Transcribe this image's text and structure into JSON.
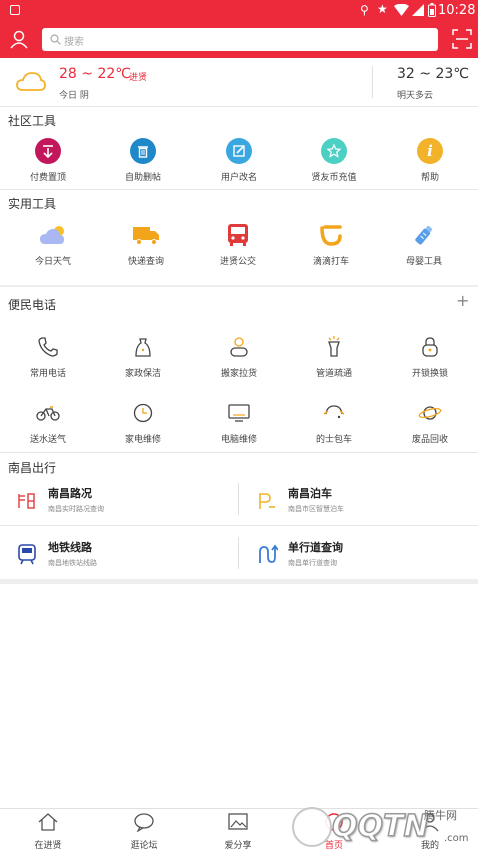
{
  "status": {
    "time": "10:28",
    "notification_icon": "photo-icon",
    "icons": [
      "location-icon",
      "star-icon",
      "wifi-icon",
      "no-sim-icon",
      "battery-icon"
    ]
  },
  "header": {
    "search_placeholder": "搜索",
    "left_icon": "user-icon",
    "right_icon": "scan-icon"
  },
  "weather": {
    "today_temp": "28 ~ 22℃",
    "today_city": "进贤",
    "today_label": "今日 阴",
    "tomorrow_temp": "32 ~ 23℃",
    "tomorrow_label": "明天多云",
    "colors": {
      "temp": "#ec2a3c"
    }
  },
  "community": {
    "title": "社区工具",
    "items": [
      {
        "label": "付费置顶",
        "icon": "pin-top-icon",
        "color": "#c2185b"
      },
      {
        "label": "自助删帖",
        "icon": "trash-icon",
        "color": "#1e88c9"
      },
      {
        "label": "用户改名",
        "icon": "edit-icon",
        "color": "#3aa7e0"
      },
      {
        "label": "贤友币充值",
        "icon": "star-icon",
        "color": "#4dd0c4"
      },
      {
        "label": "帮助",
        "icon": "info-icon",
        "color": "#f2b32a"
      }
    ]
  },
  "tools": {
    "title": "实用工具",
    "items": [
      {
        "label": "今日天气",
        "icon": "weather-icon"
      },
      {
        "label": "快递查询",
        "icon": "truck-icon"
      },
      {
        "label": "进贤公交",
        "icon": "bus-icon"
      },
      {
        "label": "滴滴打车",
        "icon": "didi-icon"
      },
      {
        "label": "母婴工具",
        "icon": "baby-bottle-icon"
      }
    ]
  },
  "phones": {
    "title": "便民电话",
    "add_icon": "plus-icon",
    "row1": [
      {
        "label": "常用电话",
        "icon": "phone-icon"
      },
      {
        "label": "家政保洁",
        "icon": "cleaning-icon"
      },
      {
        "label": "搬家拉货",
        "icon": "moving-icon"
      },
      {
        "label": "管道疏通",
        "icon": "pipe-icon"
      },
      {
        "label": "开锁换锁",
        "icon": "lock-icon"
      }
    ],
    "row2": [
      {
        "label": "送水送气",
        "icon": "bike-icon"
      },
      {
        "label": "家电维修",
        "icon": "clock-icon"
      },
      {
        "label": "电脑维修",
        "icon": "monitor-icon"
      },
      {
        "label": "的士包车",
        "icon": "taxi-icon"
      },
      {
        "label": "废品回收",
        "icon": "recycle-icon"
      }
    ]
  },
  "travel": {
    "title": "南昌出行",
    "items": [
      {
        "title": "南昌路况",
        "sub": "南昌实时路况查询",
        "icon": "traffic-icon",
        "color": "#e04848"
      },
      {
        "title": "南昌泊车",
        "sub": "南昌市区智慧泊车",
        "icon": "parking-icon",
        "color": "#f2b32a"
      },
      {
        "title": "地铁线路",
        "sub": "南昌地铁站线路",
        "icon": "metro-icon",
        "color": "#2a4aa8"
      },
      {
        "title": "单行道查询",
        "sub": "南昌单行道查询",
        "icon": "oneway-icon",
        "color": "#3a7ed8"
      }
    ]
  },
  "tabbar": [
    {
      "label": "在进贤",
      "icon": "home-icon"
    },
    {
      "label": "逛论坛",
      "icon": "chat-icon"
    },
    {
      "label": "爱分享",
      "icon": "image-icon"
    },
    {
      "label": "首页",
      "icon": "center-icon"
    },
    {
      "label": "我的",
      "icon": "profile-icon"
    }
  ],
  "watermark": {
    "brand": "QQTN",
    "site": "腾牛网",
    "url": ".com"
  }
}
